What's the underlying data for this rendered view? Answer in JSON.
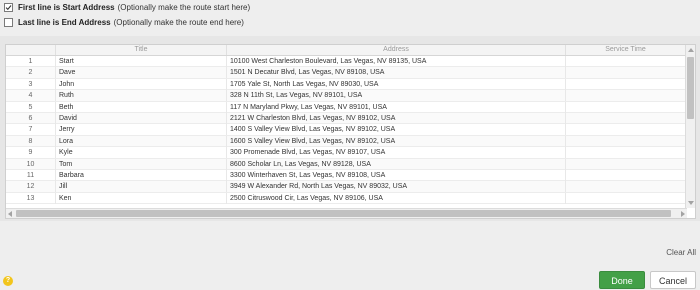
{
  "options": {
    "start": {
      "bold": "First line is Start Address",
      "note": "(Optionally make the route start here)",
      "checked": true
    },
    "end": {
      "bold": "Last line is End Address",
      "note": "(Optionally make the route end here)",
      "checked": false
    }
  },
  "grid": {
    "columns": [
      "",
      "Title",
      "Address",
      "Service Time"
    ],
    "rows": [
      {
        "n": "1",
        "title": "Start",
        "address": "10100 West Charleston Boulevard, Las Vegas, NV 89135, USA",
        "service": ""
      },
      {
        "n": "2",
        "title": "Dave",
        "address": "1501 N Decatur Blvd, Las Vegas, NV 89108, USA",
        "service": ""
      },
      {
        "n": "3",
        "title": "John",
        "address": "1705 Yale St, North Las Vegas, NV 89030, USA",
        "service": ""
      },
      {
        "n": "4",
        "title": "Ruth",
        "address": "328 N 11th St, Las Vegas, NV 89101, USA",
        "service": ""
      },
      {
        "n": "5",
        "title": "Beth",
        "address": "117 N Maryland Pkwy, Las Vegas, NV 89101, USA",
        "service": ""
      },
      {
        "n": "6",
        "title": "David",
        "address": "2121 W Charleston Blvd, Las Vegas, NV 89102, USA",
        "service": ""
      },
      {
        "n": "7",
        "title": "Jerry",
        "address": "1400 S Valley View Blvd, Las Vegas, NV 89102, USA",
        "service": ""
      },
      {
        "n": "8",
        "title": "Lora",
        "address": "1600 S Valley View Blvd, Las Vegas, NV 89102, USA",
        "service": ""
      },
      {
        "n": "9",
        "title": "Kyle",
        "address": "300 Promenade Blvd, Las Vegas, NV 89107, USA",
        "service": ""
      },
      {
        "n": "10",
        "title": "Tom",
        "address": "8600 Scholar Ln, Las Vegas, NV 89128, USA",
        "service": ""
      },
      {
        "n": "11",
        "title": "Barbara",
        "address": "3300 Winterhaven St, Las Vegas, NV 89108, USA",
        "service": ""
      },
      {
        "n": "12",
        "title": "Jill",
        "address": "3949 W Alexander Rd, North Las Vegas, NV 89032, USA",
        "service": ""
      },
      {
        "n": "13",
        "title": "Ken",
        "address": "2500 Citruswood Cir, Las Vegas, NV 89106, USA",
        "service": ""
      }
    ]
  },
  "footer": {
    "clear_all": "Clear All",
    "help": "?",
    "done": "Done",
    "cancel": "Cancel"
  },
  "colors": {
    "done_bg": "#43a047",
    "help_badge": "#f2c51b"
  }
}
